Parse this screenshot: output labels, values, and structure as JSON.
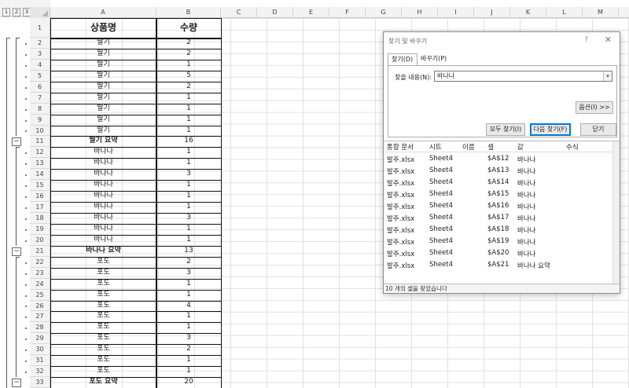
{
  "outline_levels": [
    "1",
    "2",
    "3"
  ],
  "columns": [
    "A",
    "B",
    "C",
    "D",
    "E",
    "F",
    "G",
    "H",
    "I",
    "J",
    "K",
    "L",
    "M"
  ],
  "table": {
    "header": [
      "상품명",
      "수량"
    ],
    "rows": [
      {
        "row": "2",
        "name": "딸기",
        "qty": "2"
      },
      {
        "row": "3",
        "name": "딸기",
        "qty": "2"
      },
      {
        "row": "4",
        "name": "딸기",
        "qty": "1"
      },
      {
        "row": "5",
        "name": "딸기",
        "qty": "5"
      },
      {
        "row": "6",
        "name": "딸기",
        "qty": "2"
      },
      {
        "row": "7",
        "name": "딸기",
        "qty": "1"
      },
      {
        "row": "8",
        "name": "딸기",
        "qty": "1"
      },
      {
        "row": "9",
        "name": "딸기",
        "qty": "1"
      },
      {
        "row": "10",
        "name": "딸기",
        "qty": "1"
      },
      {
        "row": "11",
        "name": "딸기 요약",
        "qty": "16",
        "summary": true
      },
      {
        "row": "12",
        "name": "바나나",
        "qty": "1"
      },
      {
        "row": "13",
        "name": "바나나",
        "qty": "1"
      },
      {
        "row": "14",
        "name": "바나나",
        "qty": "3"
      },
      {
        "row": "15",
        "name": "바나나",
        "qty": "1"
      },
      {
        "row": "16",
        "name": "바나나",
        "qty": "1"
      },
      {
        "row": "17",
        "name": "바나나",
        "qty": "1"
      },
      {
        "row": "18",
        "name": "바나나",
        "qty": "3"
      },
      {
        "row": "19",
        "name": "바나나",
        "qty": "1"
      },
      {
        "row": "20",
        "name": "바나나",
        "qty": "1"
      },
      {
        "row": "21",
        "name": "바나나 요약",
        "qty": "13",
        "summary": true
      },
      {
        "row": "22",
        "name": "포도",
        "qty": "2"
      },
      {
        "row": "23",
        "name": "포도",
        "qty": "3"
      },
      {
        "row": "24",
        "name": "포도",
        "qty": "1"
      },
      {
        "row": "25",
        "name": "포도",
        "qty": "1"
      },
      {
        "row": "26",
        "name": "포도",
        "qty": "4"
      },
      {
        "row": "27",
        "name": "포도",
        "qty": "1"
      },
      {
        "row": "28",
        "name": "포도",
        "qty": "1"
      },
      {
        "row": "29",
        "name": "포도",
        "qty": "3"
      },
      {
        "row": "30",
        "name": "포도",
        "qty": "2"
      },
      {
        "row": "31",
        "name": "포도",
        "qty": "1"
      },
      {
        "row": "32",
        "name": "포도",
        "qty": "1"
      },
      {
        "row": "33",
        "name": "포도 요약",
        "qty": "20",
        "summary": true
      }
    ]
  },
  "dialog": {
    "title": "찾기 및 바꾸기",
    "help": "?",
    "close": "✕",
    "tabs": {
      "find": "찾기(D)",
      "replace": "바꾸기(P)"
    },
    "find_label": "찾을 내용(N):",
    "find_value": "바나나",
    "options_button": "옵션(I) >>",
    "find_all_button": "모두 찾기(I)",
    "find_next_button": "다음 찾기(F)",
    "close_button": "닫기",
    "results_headers": [
      "통합 문서",
      "시트",
      "이름",
      "셀",
      "값",
      "수식"
    ],
    "results": [
      {
        "book": "발주.xlsx",
        "sheet": "Sheet4",
        "name": "",
        "cell": "$A$12",
        "value": "바나나",
        "formula": ""
      },
      {
        "book": "발주.xlsx",
        "sheet": "Sheet4",
        "name": "",
        "cell": "$A$13",
        "value": "바나나",
        "formula": ""
      },
      {
        "book": "발주.xlsx",
        "sheet": "Sheet4",
        "name": "",
        "cell": "$A$14",
        "value": "바나나",
        "formula": ""
      },
      {
        "book": "발주.xlsx",
        "sheet": "Sheet4",
        "name": "",
        "cell": "$A$15",
        "value": "바나나",
        "formula": ""
      },
      {
        "book": "발주.xlsx",
        "sheet": "Sheet4",
        "name": "",
        "cell": "$A$16",
        "value": "바나나",
        "formula": ""
      },
      {
        "book": "발주.xlsx",
        "sheet": "Sheet4",
        "name": "",
        "cell": "$A$17",
        "value": "바나나",
        "formula": ""
      },
      {
        "book": "발주.xlsx",
        "sheet": "Sheet4",
        "name": "",
        "cell": "$A$18",
        "value": "바나나",
        "formula": ""
      },
      {
        "book": "발주.xlsx",
        "sheet": "Sheet4",
        "name": "",
        "cell": "$A$19",
        "value": "바나나",
        "formula": ""
      },
      {
        "book": "발주.xlsx",
        "sheet": "Sheet4",
        "name": "",
        "cell": "$A$20",
        "value": "바나나",
        "formula": ""
      },
      {
        "book": "발주.xlsx",
        "sheet": "Sheet4",
        "name": "",
        "cell": "$A$21",
        "value": "바나나 요약",
        "formula": ""
      }
    ],
    "status": "10 개의 셀을 찾았습니다"
  }
}
